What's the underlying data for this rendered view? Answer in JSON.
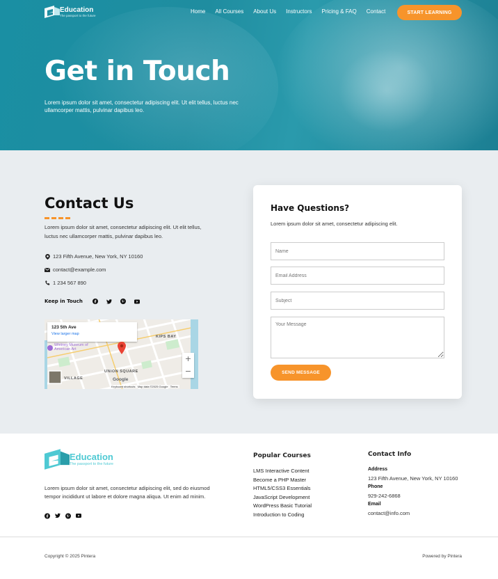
{
  "brand": {
    "name": "Education",
    "tagline": "The passport to the future"
  },
  "nav": {
    "links": [
      "Home",
      "All Courses",
      "About Us",
      "Instructors",
      "Pricing & FAQ",
      "Contact"
    ],
    "cta": "START LEARNING"
  },
  "hero": {
    "title": "Get in Touch",
    "text": "Lorem ipsum dolor sit amet, consectetur adipiscing elit. Ut elit tellus, luctus nec ullamcorper mattis, pulvinar dapibus leo."
  },
  "contact": {
    "title": "Contact Us",
    "text": "Lorem ipsum dolor sit amet, consectetur adipiscing elit. Ut elit tellus, luctus nec ullamcorper mattis, pulvinar dapibus leo.",
    "address": "123 Fifth Avenue, New York, NY 10160",
    "email": "contact@example.com",
    "phone": "1 234 567 890",
    "keep_in_touch": "Keep in Touch",
    "icons": {
      "address": "map-pin-icon",
      "email": "envelope-icon",
      "phone": "phone-icon"
    },
    "social_icons": [
      "facebook-icon",
      "twitter-icon",
      "pinterest-icon",
      "youtube-icon"
    ]
  },
  "map": {
    "place": "123 5th Ave",
    "link": "View larger map",
    "labels": {
      "kips": "KIPS BAY",
      "union": "UNION SQUARE",
      "village": "VILLAGE",
      "museum": "Whitney Museum of American Art",
      "google": "Google"
    },
    "zoom_in": "+",
    "zoom_out": "−",
    "footer": [
      "Keyboard shortcuts",
      "Map data ©2025 Google",
      "Terms"
    ]
  },
  "form": {
    "title": "Have Questions?",
    "text": "Lorem ipsum dolor sit amet, consectetur adipiscing elit.",
    "name_placeholder": "Name",
    "email_placeholder": "Email Address",
    "subject_placeholder": "Subject",
    "message_placeholder": "Your Message",
    "submit": "SEND MESSAGE"
  },
  "footer": {
    "text": "Lorem ipsum dolor sit amet, consectetur adipiscing elit, sed do eiusmod tempor incididunt ut labore et dolore magna aliqua. Ut enim ad minim.",
    "courses_title": "Popular Courses",
    "courses": [
      "LMS Interactive Content",
      "Become a PHP Master",
      "HTML5/CSS3 Essentials",
      "JavaScript Development",
      "WordPress Basic Tutorial",
      "Introduction to Coding"
    ],
    "info_title": "Contact Info",
    "address_label": "Address",
    "address": "123 Fifth Avenue, New York, NY 10160",
    "phone_label": "Phone",
    "phone": "929-242-6868",
    "email_label": "Email",
    "email": "contact@info.com",
    "copyright": "Copyright © 2025 Pintera",
    "powered": "Powered by Pintera"
  },
  "colors": {
    "accent": "#f7942b",
    "hero": "#1f8da0",
    "brand_teal": "#4ec9d3",
    "section_bg": "#e9edf0"
  }
}
